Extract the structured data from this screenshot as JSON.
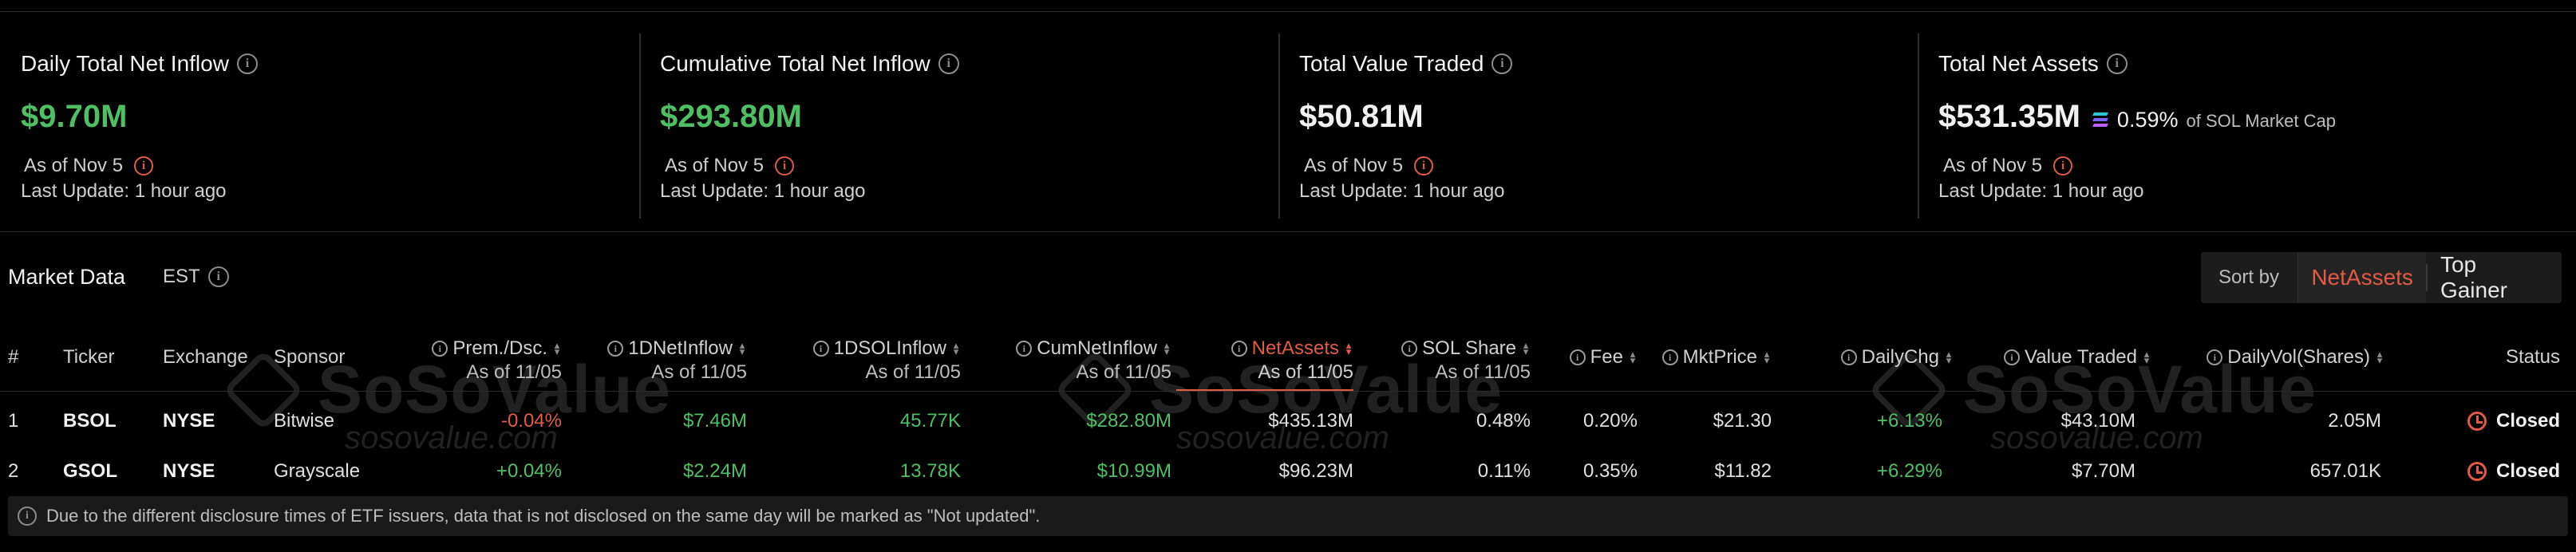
{
  "cards": [
    {
      "title": "Daily Total Net Inflow",
      "value": "$9.70M",
      "as_of": "As of Nov 5",
      "last_update": "Last Update: 1 hour ago"
    },
    {
      "title": "Cumulative Total Net Inflow",
      "value": "$293.80M",
      "as_of": "As of Nov 5",
      "last_update": "Last Update: 1 hour ago"
    },
    {
      "title": "Total Value Traded",
      "value": "$50.81M",
      "as_of": "As of Nov 5",
      "last_update": "Last Update: 1 hour ago"
    },
    {
      "title": "Total Net Assets",
      "value": "$531.35M",
      "share_pct": "0.59%",
      "share_text": "of SOL Market Cap",
      "as_of": "As of Nov 5",
      "last_update": "Last Update: 1 hour ago"
    }
  ],
  "market": {
    "title": "Market Data",
    "timezone": "EST",
    "sort_label": "Sort by",
    "sort_options": [
      "NetAssets",
      "Top Gainer"
    ],
    "active_sort": "NetAssets"
  },
  "columns": {
    "num": "#",
    "ticker": "Ticker",
    "exchange": "Exchange",
    "sponsor": "Sponsor",
    "prem": {
      "label": "Prem./Dsc.",
      "sub": "As of 11/05"
    },
    "inflow": {
      "label": "1DNetInflow",
      "sub": "As of 11/05"
    },
    "solinflow": {
      "label": "1DSOLInflow",
      "sub": "As of 11/05"
    },
    "cuminflow": {
      "label": "CumNetInflow",
      "sub": "As of 11/05"
    },
    "netassets": {
      "label": "NetAssets",
      "sub": "As of 11/05"
    },
    "solshare": {
      "label": "SOL Share",
      "sub": "As of 11/05"
    },
    "fee": "Fee",
    "mktprice": "MktPrice",
    "dailychg": "DailyChg",
    "valuetraded": "Value Traded",
    "dailyvol": "DailyVol(Shares)",
    "status": "Status"
  },
  "rows": [
    {
      "num": "1",
      "ticker": "BSOL",
      "exchange": "NYSE",
      "sponsor": "Bitwise",
      "prem": "-0.04%",
      "inflow": "$7.46M",
      "solinflow": "45.77K",
      "cuminflow": "$282.80M",
      "netassets": "$435.13M",
      "solshare": "0.48%",
      "fee": "0.20%",
      "mktprice": "$21.30",
      "dailychg": "+6.13%",
      "valuetraded": "$43.10M",
      "dailyvol": "2.05M",
      "status": "Closed"
    },
    {
      "num": "2",
      "ticker": "GSOL",
      "exchange": "NYSE",
      "sponsor": "Grayscale",
      "prem": "+0.04%",
      "inflow": "$2.24M",
      "solinflow": "13.78K",
      "cuminflow": "$10.99M",
      "netassets": "$96.23M",
      "solshare": "0.11%",
      "fee": "0.35%",
      "mktprice": "$11.82",
      "dailychg": "+6.29%",
      "valuetraded": "$7.70M",
      "dailyvol": "657.01K",
      "status": "Closed"
    }
  ],
  "watermark": {
    "name": "SoSoValue",
    "url": "sosovalue.com"
  },
  "footnote": "Due to the different disclosure times of ETF issuers, data that is not disclosed on the same day will be marked as \"Not updated\".",
  "colors": {
    "positive": "#4ec063",
    "negative": "#e25b45",
    "accent": "#e25b45",
    "background": "#000000"
  }
}
